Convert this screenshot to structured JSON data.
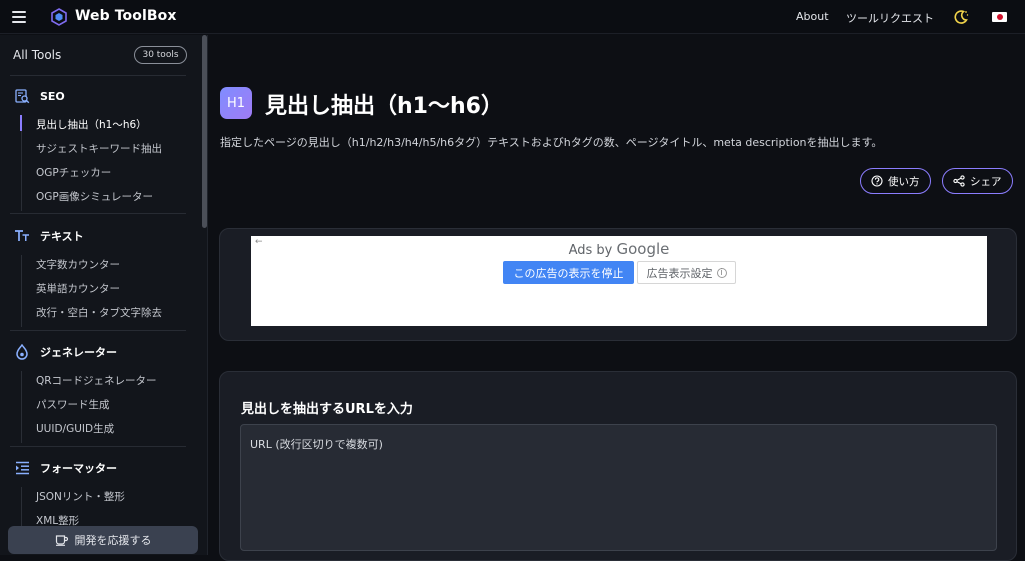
{
  "header": {
    "brand": "Web ToolBox",
    "nav": {
      "about": "About",
      "request": "ツールリクエスト"
    },
    "icons": [
      "hamburger-icon",
      "logo-icon",
      "moon-icon",
      "japan-flag-icon"
    ]
  },
  "sidebar": {
    "title": "All Tools",
    "count": "30 tools",
    "categories": [
      {
        "label": "SEO",
        "icon": "seo-search-icon",
        "items": [
          "見出し抽出（h1〜h6）",
          "サジェストキーワード抽出",
          "OGPチェッカー",
          "OGP画像シミュレーター"
        ]
      },
      {
        "label": "テキスト",
        "icon": "text-icon",
        "items": [
          "文字数カウンター",
          "英単語カウンター",
          "改行・空白・タブ文字除去"
        ]
      },
      {
        "label": "ジェネレーター",
        "icon": "generator-icon",
        "items": [
          "QRコードジェネレーター",
          "パスワード生成",
          "UUID/GUID生成"
        ]
      },
      {
        "label": "フォーマッター",
        "icon": "formatter-icon",
        "items": [
          "JSONリント・整形",
          "XML整形"
        ]
      }
    ],
    "support_label": "開発を応援する"
  },
  "main": {
    "badge": "H1",
    "title": "見出し抽出（h1〜h6）",
    "description": "指定したページの見出し（h1/h2/h3/h4/h5/h6タグ）テキストおよびhタグの数、ページタイトル、meta descriptionを抽出します。",
    "usage_label": "使い方",
    "share_label": "シェア",
    "ad": {
      "ads_by": "Ads by",
      "google": "Google",
      "stop_label": "この広告の表示を停止",
      "settings_label": "広告表示設定"
    },
    "form": {
      "heading": "見出しを抽出するURLを入力",
      "placeholder": "URL (改行区切りで複数可)"
    }
  },
  "colors": {
    "accent": "#8b7dff",
    "background": "#0d0f14",
    "card": "#1a1d25",
    "ad_button": "#4285f4"
  }
}
